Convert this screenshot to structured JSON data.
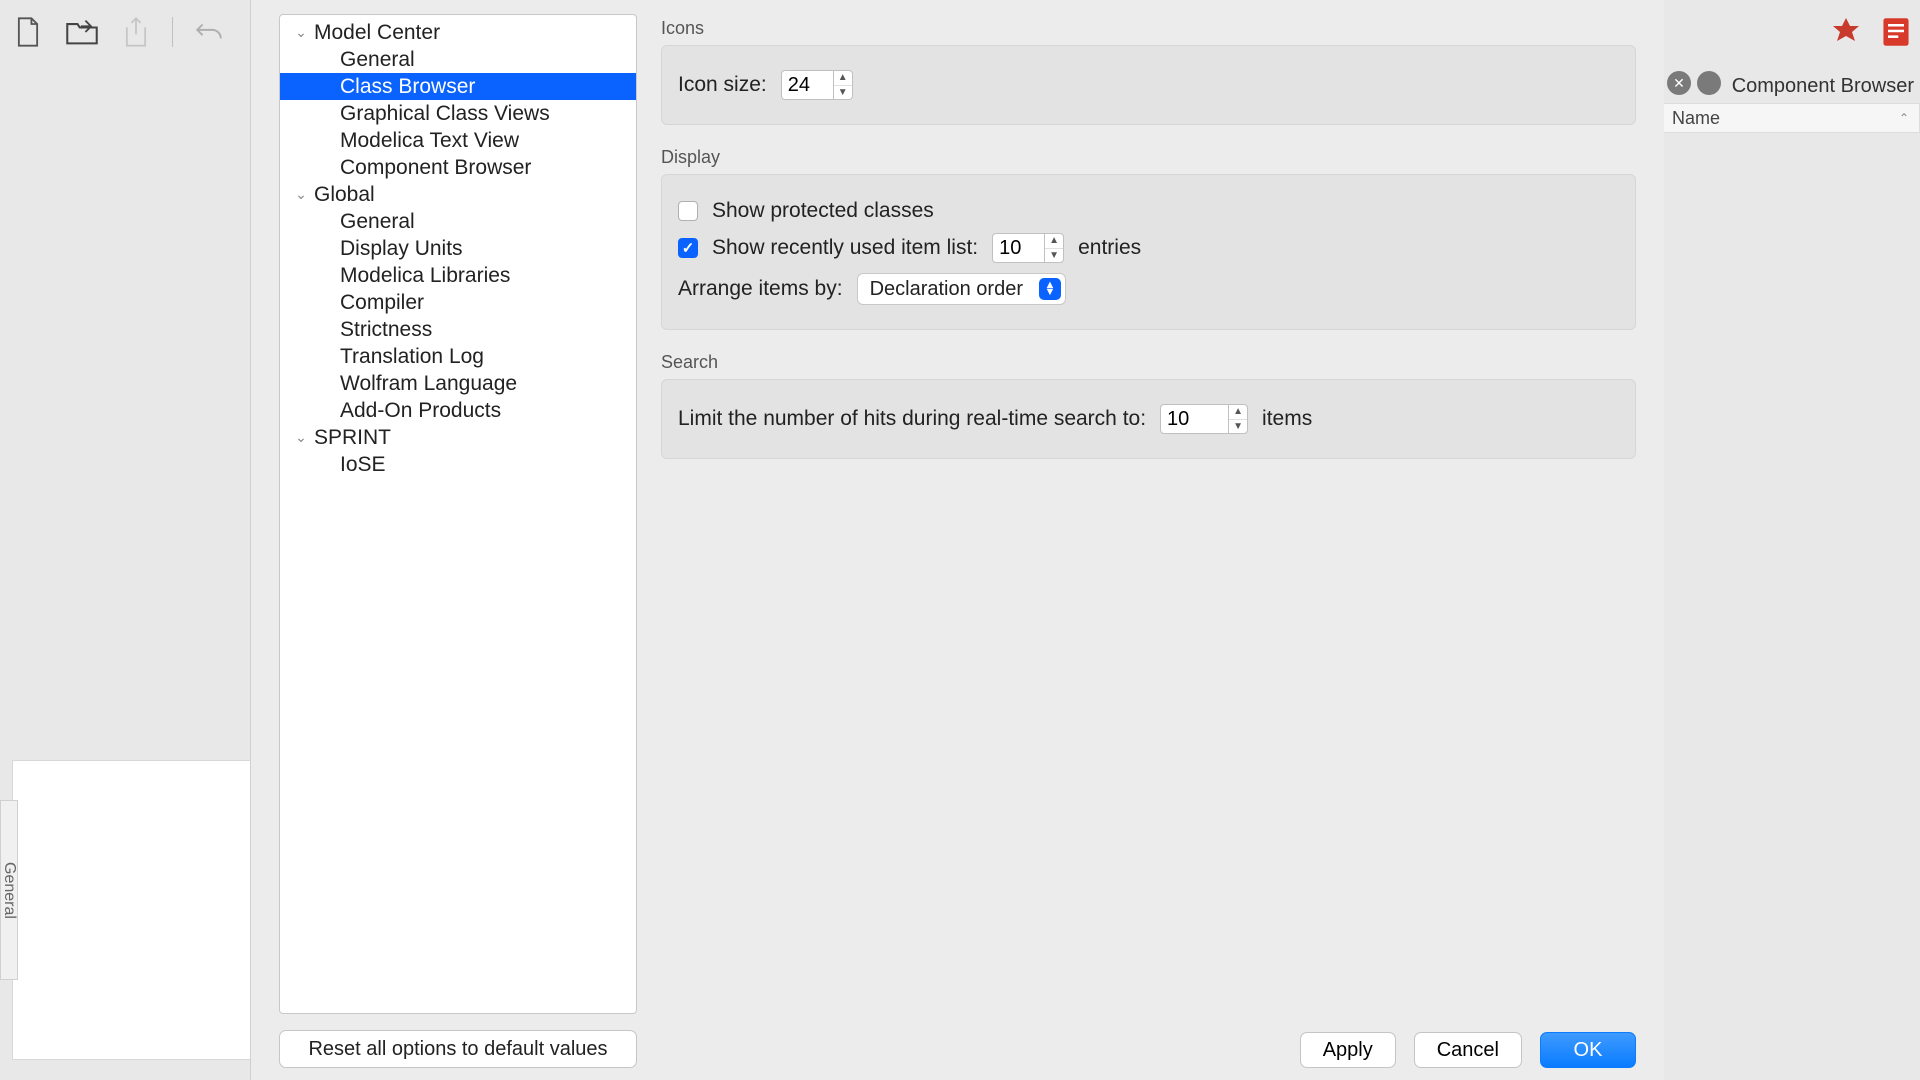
{
  "toolbar": {
    "new_icon": "new-file",
    "open_icon": "open-folder",
    "export_icon": "export",
    "undo_icon": "undo"
  },
  "right_panel": {
    "title": "Component Browser",
    "col_name": "Name"
  },
  "sidebar": {
    "groups": [
      {
        "label": "Model Center",
        "items": [
          "General",
          "Class Browser",
          "Graphical Class Views",
          "Modelica Text View",
          "Component Browser"
        ]
      },
      {
        "label": "Global",
        "items": [
          "General",
          "Display Units",
          "Modelica Libraries",
          "Compiler",
          "Strictness",
          "Translation Log",
          "Wolfram Language",
          "Add-On Products"
        ]
      },
      {
        "label": "SPRINT",
        "items": [
          "IoSE"
        ]
      }
    ],
    "selected": "Class Browser"
  },
  "reset_label": "Reset all options to default values",
  "content": {
    "icons_section": "Icons",
    "icon_size_label": "Icon size:",
    "icon_size_value": "24",
    "display_section": "Display",
    "show_protected_label": "Show protected classes",
    "show_protected_checked": false,
    "show_recent_label": "Show recently used item list:",
    "show_recent_checked": true,
    "show_recent_value": "10",
    "show_recent_suffix": "entries",
    "arrange_label": "Arrange items by:",
    "arrange_value": "Declaration order",
    "search_section": "Search",
    "search_limit_label": "Limit the number of hits during real-time search to:",
    "search_limit_value": "10",
    "search_limit_suffix": "items"
  },
  "buttons": {
    "apply": "Apply",
    "cancel": "Cancel",
    "ok": "OK"
  },
  "left_strip": "General"
}
